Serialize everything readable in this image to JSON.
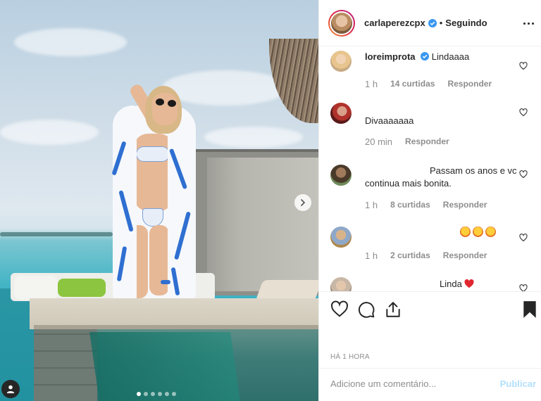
{
  "post": {
    "carousel": {
      "count": 6,
      "active_index": 0
    }
  },
  "header": {
    "username": "carlaperezcpx",
    "separator": "•",
    "follow_status": "Seguindo"
  },
  "comments": [
    {
      "username": "loreimprota",
      "verified": true,
      "text": "Lindaaaa",
      "time": "1 h",
      "likes": "14 curtidas",
      "reply": "Responder"
    },
    {
      "username": "",
      "verified": false,
      "text": "Divaaaaaaa",
      "time": "20 min",
      "likes": "",
      "reply": "Responder"
    },
    {
      "username": "",
      "verified": false,
      "text": "Passam os anos e vc continua mais bonita.",
      "time": "1 h",
      "likes": "8 curtidas",
      "reply": "Responder"
    },
    {
      "username": "",
      "verified": false,
      "text": "",
      "time": "1 h",
      "likes": "2 curtidas",
      "reply": "Responder"
    },
    {
      "username": "",
      "verified": false,
      "text": "Linda",
      "time": "",
      "likes": "",
      "reply": ""
    }
  ],
  "timestamp": "HÁ 1 HORA",
  "add_comment": {
    "placeholder": "Adicione um comentário...",
    "publish": "Publicar"
  },
  "icons": {
    "like": "heart-icon",
    "comment": "comment-icon",
    "share": "share-icon",
    "save": "bookmark-icon",
    "more": "more-options-icon",
    "next": "chevron-right-icon",
    "tag": "user-tag-icon"
  },
  "colors": {
    "verified": "#3897f0",
    "publish_disabled": "#b2dffc",
    "meta": "#8e8e8e",
    "text": "#262626"
  }
}
